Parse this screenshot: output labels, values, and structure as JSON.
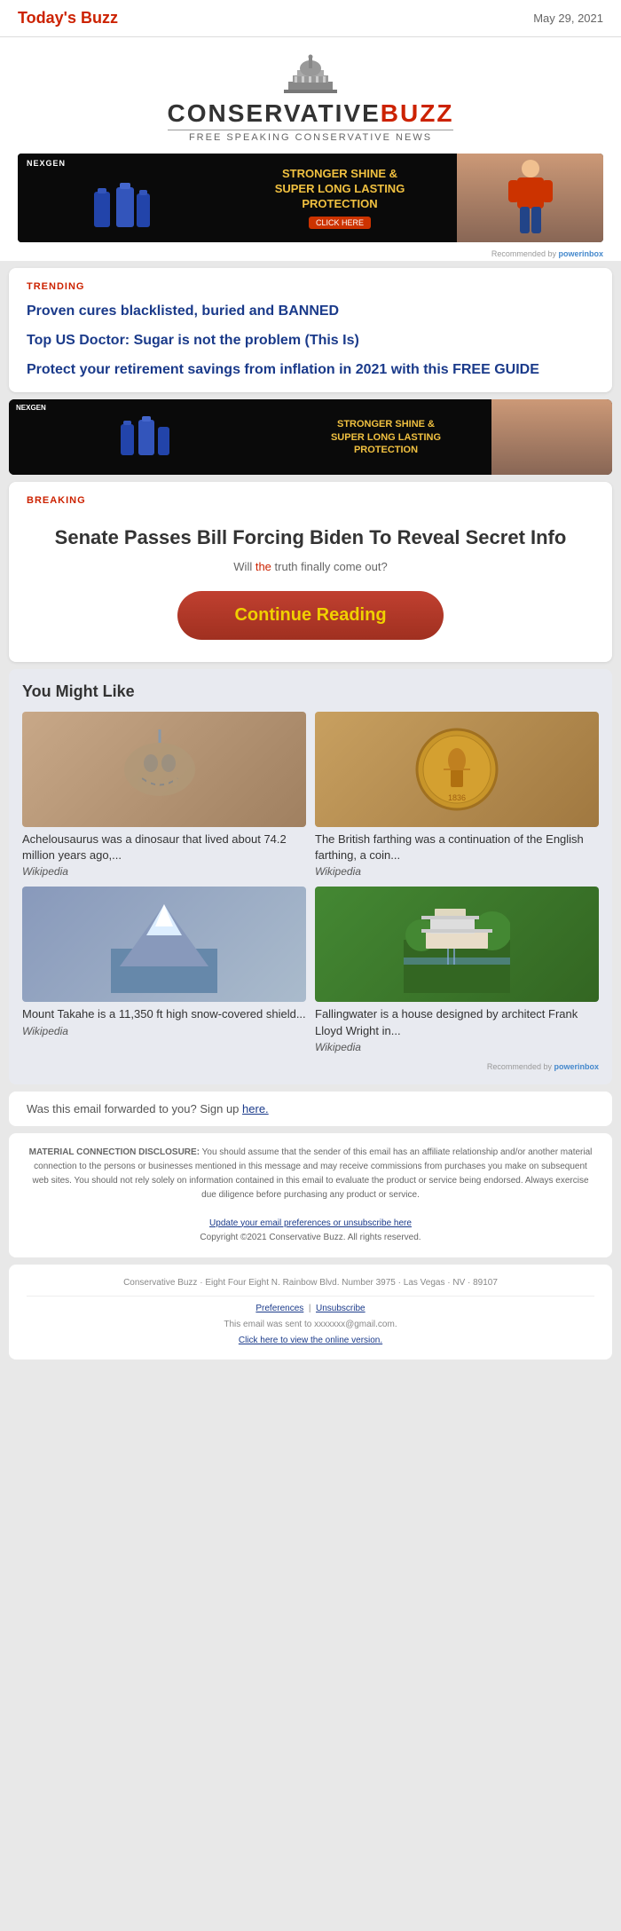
{
  "header": {
    "title_prefix": "Today's ",
    "title_highlight": "Buzz",
    "date": "May 29, 2021"
  },
  "logo": {
    "conservative": "CONSERVATIVE",
    "buzz": "BUZZ",
    "tagline": "Free Speaking Conservative News"
  },
  "ad1": {
    "brand": "NEXGEN",
    "headline": "STRONGER SHINE &",
    "subheadline": "SUPER LONG LASTING",
    "protection": "PROTECTION",
    "recommended_by": "Recommended by",
    "powerinbox": "powerinbox"
  },
  "trending": {
    "section_label": "TRENDING",
    "items": [
      {
        "text": "Proven cures blacklisted, buried and BANNED"
      },
      {
        "text": "Top US Doctor: Sugar is not the problem (This Is)"
      },
      {
        "text": "Protect your retirement savings from inflation in 2021 with this FREE GUIDE"
      }
    ]
  },
  "breaking": {
    "section_label": "BREAKING",
    "headline": "Senate Passes Bill Forcing Biden To Reveal Secret Info",
    "subtext_prefix": "Will ",
    "subtext_highlight": "the",
    "subtext_suffix": " truth finally come out?",
    "continue_reading": "Continue Reading"
  },
  "might_like": {
    "title": "You Might Like",
    "items": [
      {
        "desc": "Achelousaurus was a dinosaur that lived about 74.2 million years ago,...",
        "source": "Wikipedia",
        "color": "#b8a090"
      },
      {
        "desc": "The British farthing was a continuation of the English farthing, a coin...",
        "source": "Wikipedia",
        "color": "#c8a060"
      },
      {
        "desc": "Mount Takahe is a 11,350 ft high snow-covered shield...",
        "source": "Wikipedia",
        "color": "#8899aa"
      },
      {
        "desc": "Fallingwater is a house designed by architect Frank Lloyd Wright in...",
        "source": "Wikipedia",
        "color": "#556644"
      }
    ],
    "recommended_by": "Recommended by",
    "powerinbox": "powerinbox"
  },
  "forward": {
    "text": "Was this email forwarded to you? Sign up ",
    "link_text": "here."
  },
  "disclosure": {
    "title": "MATERIAL CONNECTION DISCLOSURE:",
    "text": "You should assume that the sender of this email has an affiliate relationship and/or another material connection to the persons or businesses mentioned in this message and may receive commissions from purchases you make on subsequent web sites. You should not rely solely on information contained in this email to evaluate the product or service being endorsed. Always exercise due diligence before purchasing any product or service.",
    "preferences_text": "Update your email preferences or unsubscribe here",
    "copyright": "Copyright ©2021 Conservative Buzz. All rights reserved."
  },
  "footer": {
    "address": "Conservative Buzz · Eight Four Eight N. Rainbow Blvd. Number 3975 · Las Vegas · NV · 89107",
    "preferences_link": "Preferences",
    "unsubscribe_link": "Unsubscribe",
    "email_sent_to": "This email was sent to xxxxxxx@gmail.com.",
    "view_online_text": "Click here to view the online version."
  }
}
